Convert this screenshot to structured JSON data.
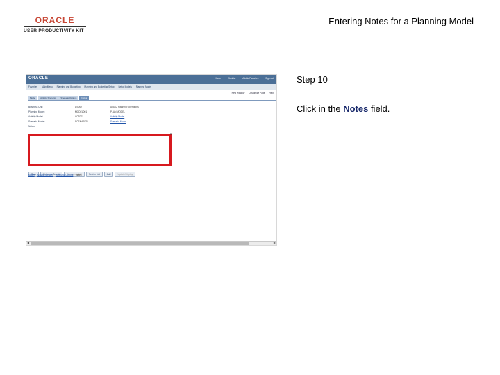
{
  "brand": {
    "logo_text": "ORACLE",
    "subtitle": "USER PRODUCTIVITY KIT"
  },
  "slide_title": "Entering Notes for a Planning Model",
  "step": {
    "label": "Step 10",
    "instruction_prefix": "Click in the ",
    "instruction_field": "Notes",
    "instruction_suffix": " field."
  },
  "screenshot": {
    "header_logo": "ORACLE",
    "header_links": [
      "Home",
      "Worklist",
      "Add to Favorites",
      "Sign out"
    ],
    "menubar": [
      "Favorites",
      "Main Menu",
      "Planning and Budgeting",
      "Planning and Budgeting Setup",
      "Setup Models",
      "Planning Model"
    ],
    "toolbar": [
      "New Window",
      "Customize Page",
      "Help"
    ],
    "tabs": [
      {
        "label": "Model",
        "active": false
      },
      {
        "label": "Activity Scenario",
        "active": false
      },
      {
        "label": "Scenario Options",
        "active": false
      },
      {
        "label": "Notes",
        "active": true
      }
    ],
    "fields": [
      {
        "label": "Business Unit:",
        "value": "US002",
        "extra": "US002 Planning Operations",
        "link": false
      },
      {
        "label": "Planning Model:",
        "value": "MODEL001",
        "extra": "PLAN MODEL",
        "link": false
      },
      {
        "label": "Activity Model:",
        "value": "ACT001",
        "extra": "Activity Model",
        "link": true
      },
      {
        "label": "Scenario Model:",
        "value": "SCENARIO1",
        "extra": "Scenario Model",
        "link": true
      }
    ],
    "notes_label": "Notes",
    "buttons": [
      {
        "label": "Save",
        "disabled": false
      },
      {
        "label": "Return to Search",
        "disabled": false
      },
      {
        "label": "Previous in List",
        "disabled": true
      },
      {
        "label": "Next in List",
        "disabled": false
      },
      {
        "label": "Add",
        "disabled": false
      },
      {
        "label": "Update/Display",
        "disabled": true
      }
    ],
    "footer_links": [
      "Model",
      "Activity Scenario",
      "Scenario Options"
    ],
    "footer_current": "Notes"
  }
}
